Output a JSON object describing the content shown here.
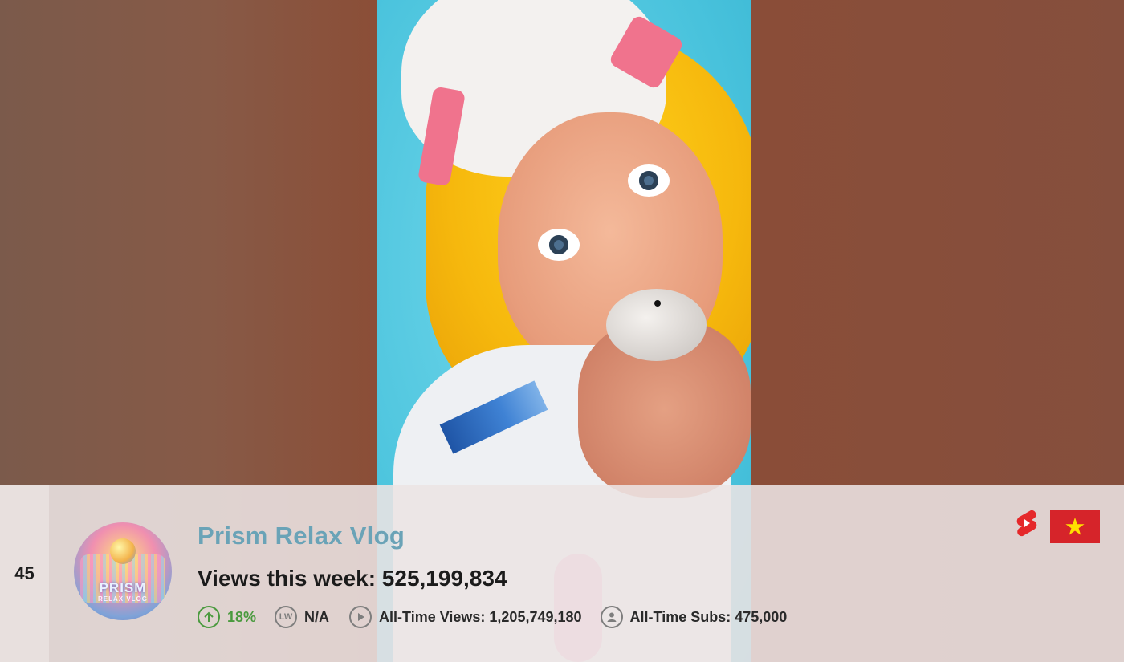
{
  "entry": {
    "rank": "45",
    "channel_name": "Prism Relax Vlog",
    "views_this_week_label": "Views this week: 525,199,834",
    "growth_percent": "18%",
    "last_week_label": "N/A",
    "all_time_views_label": "All-Time Views: 1,205,749,180",
    "all_time_subs_label": "All-Time Subs: 475,000",
    "avatar": {
      "title_text": "PRISM",
      "subtitle_text": "RELAX VLOG"
    },
    "platform_icon": "youtube-shorts-icon",
    "country_flag": "vietnam-flag"
  },
  "icons": {
    "growth": "arrow-up-circle-icon",
    "last_week": "lw-badge-icon",
    "views": "play-circle-icon",
    "subs": "user-circle-icon",
    "last_week_text": "LW"
  },
  "colors": {
    "channel_name": "#6aa3b7",
    "growth": "#4a9a3e",
    "shorts_red": "#e5282a",
    "flag_red": "#d6242a",
    "flag_star": "#ffdf00"
  }
}
